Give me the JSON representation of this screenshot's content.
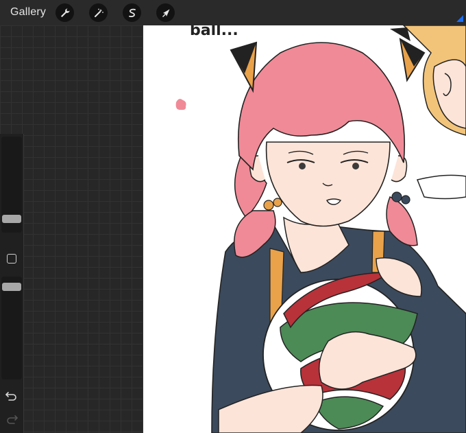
{
  "app": {
    "gallery_label": "Gallery"
  },
  "toolbar": {
    "tools": [
      {
        "name": "actions",
        "icon": "wrench-icon"
      },
      {
        "name": "adjustments",
        "icon": "magic-wand-icon"
      },
      {
        "name": "selection",
        "icon": "selection-s-icon"
      },
      {
        "name": "transform",
        "icon": "arrow-cursor-icon"
      }
    ]
  },
  "sidebar": {
    "brush_size_level": 0.1,
    "brush_opacity_level": 0.95,
    "modify_button_icon": "square-icon",
    "undo_icon": "undo-arrow-icon",
    "redo_icon": "redo-arrow-icon"
  },
  "canvas": {
    "handwritten_text": "ball...",
    "colors": {
      "hair": "#f08a97",
      "skin": "#fde4d8",
      "jacket": "#3b4a5c",
      "ball_red": "#b8323a",
      "ball_green": "#4c8a56",
      "orange": "#e9a24a"
    }
  },
  "colors": {
    "topbar": "#2a2a2a",
    "panel": "#272727",
    "accent": "#1c6ef2"
  }
}
